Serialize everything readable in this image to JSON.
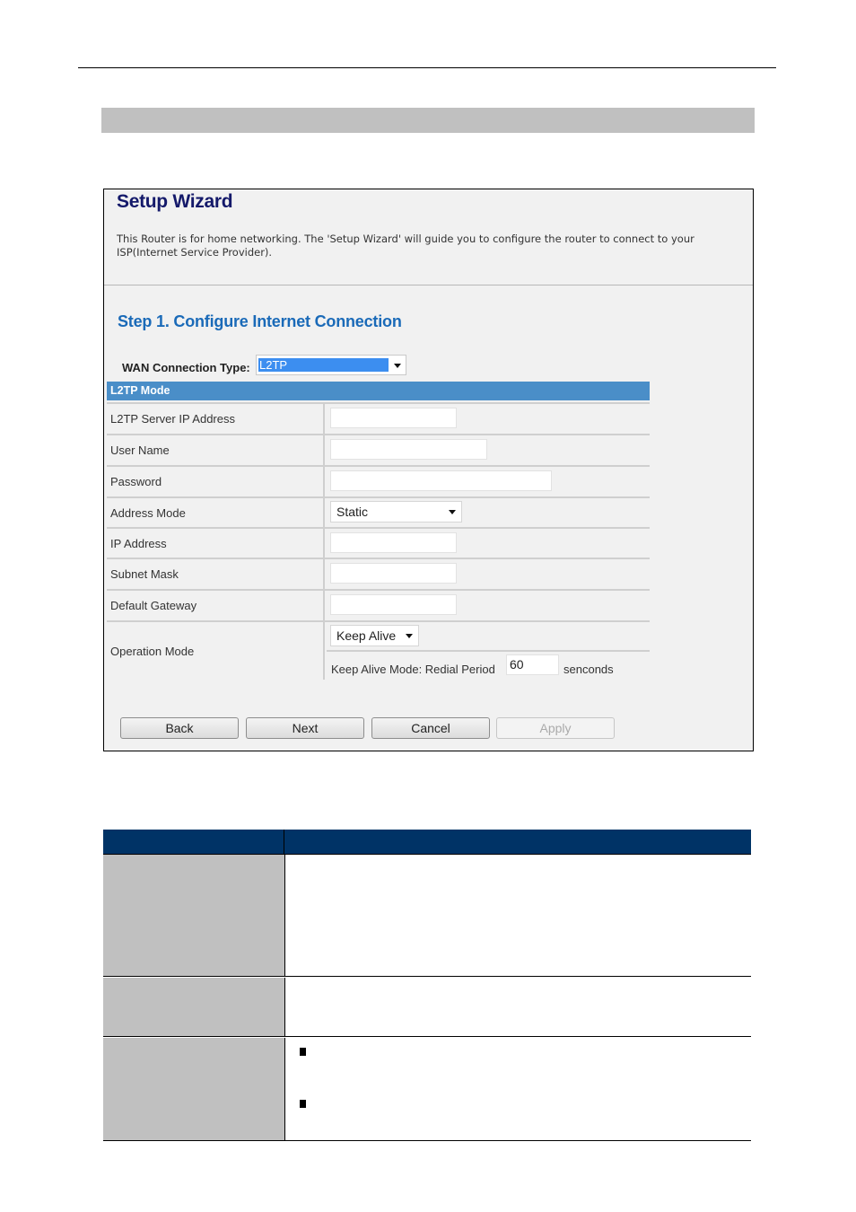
{
  "window": {
    "title": "Setup Wizard",
    "description": "This Router is for home networking. The 'Setup Wizard' will guide you to configure the router to connect to your ISP(Internet Service Provider)."
  },
  "step": {
    "title": "Step 1. Configure Internet Connection",
    "wan_label": "WAN Connection Type:",
    "wan_value": "L2TP"
  },
  "form": {
    "section_title": "L2TP Mode",
    "fields": [
      {
        "label": "L2TP Server IP Address",
        "value": ""
      },
      {
        "label": "User Name",
        "value": ""
      },
      {
        "label": "Password",
        "value": ""
      },
      {
        "label": "Address Mode",
        "value": "Static"
      },
      {
        "label": "IP Address",
        "value": ""
      },
      {
        "label": "Subnet Mask",
        "value": ""
      },
      {
        "label": "Default Gateway",
        "value": ""
      },
      {
        "label": "Operation Mode",
        "value": "Keep Alive"
      }
    ],
    "keep_alive": {
      "label": "Keep Alive Mode: Redial Period",
      "value": "60",
      "unit": "senconds"
    }
  },
  "buttons": {
    "back": "Back",
    "next": "Next",
    "cancel": "Cancel",
    "apply": "Apply"
  },
  "colors": {
    "title": "#14196a",
    "step_title": "#1a6ab8",
    "mode_bar": "#4a8ec8",
    "table_header": "#003366",
    "table_label_bg": "#c0c0c0"
  }
}
